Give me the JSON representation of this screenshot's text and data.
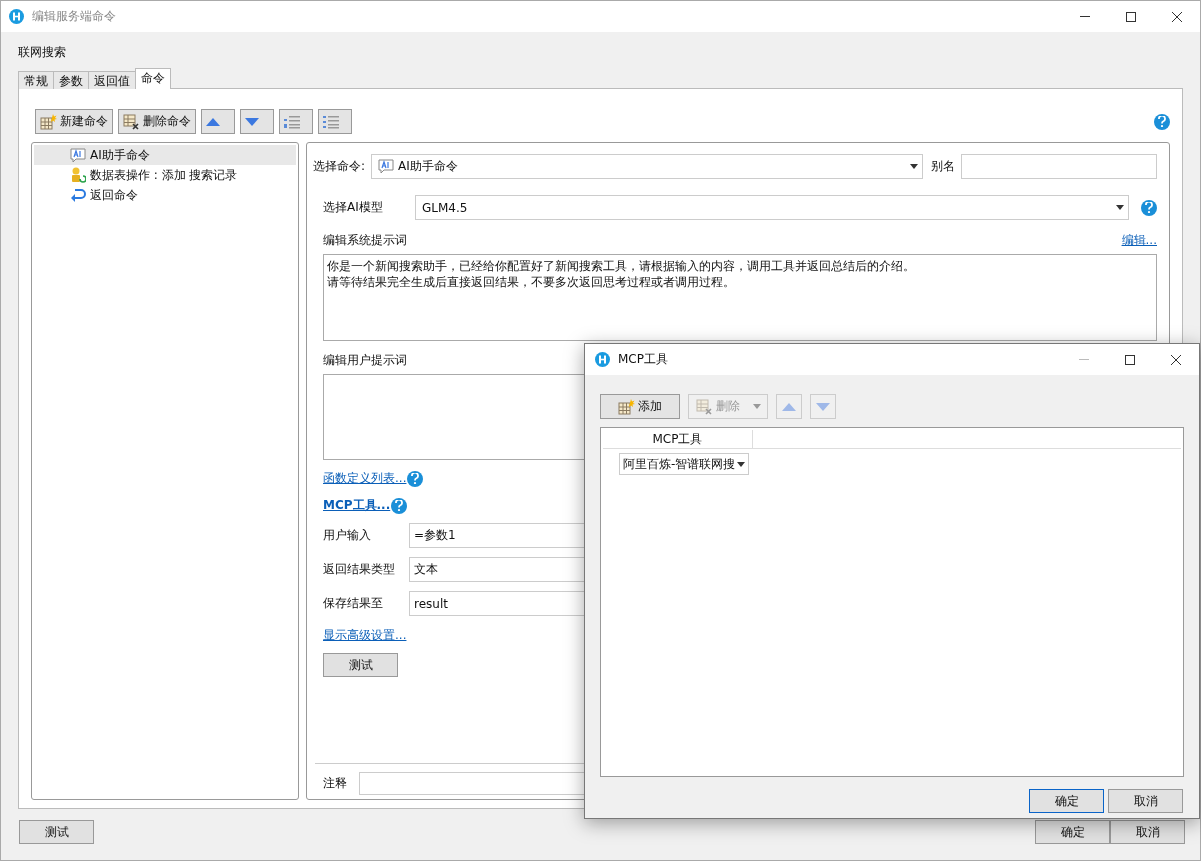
{
  "window": {
    "title": "编辑服务端命令"
  },
  "heading": "联网搜索",
  "tabs": [
    {
      "label": "常规",
      "selected": false
    },
    {
      "label": "参数",
      "selected": false
    },
    {
      "label": "返回值",
      "selected": false
    },
    {
      "label": "命令",
      "selected": true
    }
  ],
  "toolbar": [
    {
      "kind": "new",
      "label": "新建命令"
    },
    {
      "kind": "delete",
      "label": "删除命令"
    },
    {
      "kind": "up"
    },
    {
      "kind": "down"
    },
    {
      "kind": "indent"
    },
    {
      "kind": "outdent"
    }
  ],
  "tree": [
    {
      "kind": "ai",
      "label": "AI助手命令",
      "selected": true
    },
    {
      "kind": "table",
      "label": "数据表操作 : 添加 搜索记录",
      "selected": false
    },
    {
      "kind": "return",
      "label": "返回命令",
      "selected": false
    }
  ],
  "editor": {
    "command_label": "选择命令:",
    "command_value": "AI助手命令",
    "alias_label": "别名",
    "model_label": "选择AI模型",
    "model_value": "GLM4.5",
    "system_prompt_label": "编辑系统提示词",
    "system_prompt_link": "编辑...",
    "system_prompt": [
      "你是一个新闻搜索助手，已经给你配置好了新闻搜索工具，请根据输入的内容，调用工具并返回总结后的介绍。",
      "请等待结果完全生成后直接返回结果，不要多次返回思考过程或者调用过程。"
    ],
    "user_prompt_label": "编辑用户提示词",
    "function_link": "函数定义列表...",
    "mcp_link": "MCP工具...",
    "fields": [
      {
        "label": "用户输入",
        "value": "=参数1"
      },
      {
        "label": "返回结果类型",
        "value": "文本"
      },
      {
        "label": "保存结果至",
        "value": "result"
      }
    ],
    "advanced_link": "显示高级设置...",
    "test_button": "测试",
    "note_label": "注释"
  },
  "footer": {
    "test_button": "测试",
    "ok_button": "确定",
    "cancel_button": "取消"
  },
  "dialog": {
    "title": "MCP工具",
    "toolbar": [
      {
        "kind": "add",
        "label": "添加",
        "disabled": false
      },
      {
        "kind": "delete",
        "label": "删除",
        "disabled": true
      },
      {
        "kind": "up",
        "disabled": true
      },
      {
        "kind": "down",
        "disabled": true
      }
    ],
    "columns": [
      "MCP工具"
    ],
    "rows": [
      {
        "cells": [
          "阿里百炼-智谱联网搜"
        ]
      }
    ],
    "ok_button": "确定",
    "cancel_button": "取消"
  }
}
